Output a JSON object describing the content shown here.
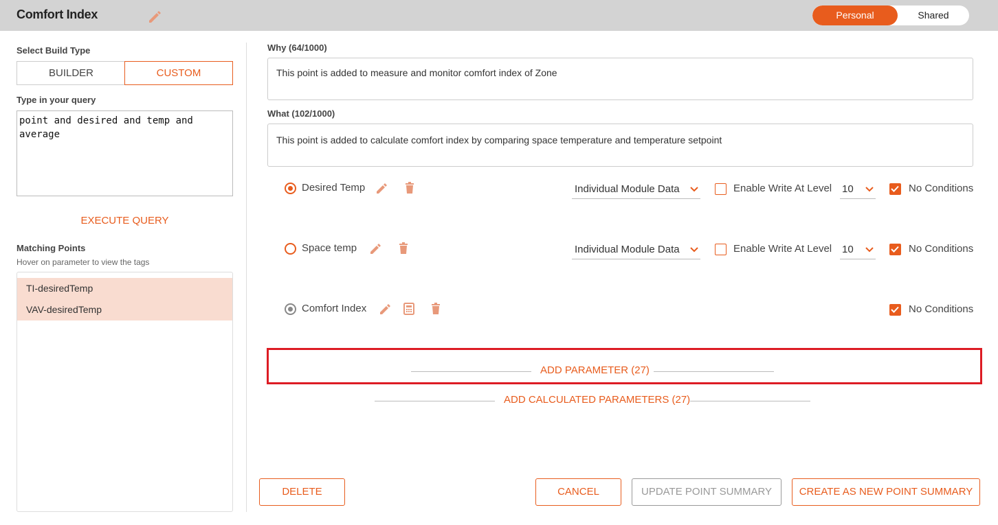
{
  "header": {
    "title": "Comfort Index",
    "toggle": {
      "personal": "Personal",
      "shared": "Shared",
      "selected": "Personal"
    }
  },
  "left": {
    "build_type_label": "Select Build Type",
    "builder_label": "BUILDER",
    "custom_label": "CUSTOM",
    "query_label": "Type in your query",
    "query_value": "point and desired and temp and\naverage",
    "execute_label": "EXECUTE QUERY",
    "matching_label": "Matching Points",
    "matching_hint": "Hover on parameter to view the tags",
    "matching_points": [
      "TI-desiredTemp",
      "VAV-desiredTemp"
    ]
  },
  "right": {
    "why_label": "Why (64/1000)",
    "why_value": "This point is added to measure and monitor comfort index of Zone",
    "what_label": "What (102/1000)",
    "what_value": "This point is added to calculate comfort index by comparing space temperature and temperature setpoint",
    "params": [
      {
        "name": "Desired Temp",
        "data_source": "Individual Module Data",
        "write_label": "Enable Write At Level",
        "level": "10",
        "conditions_label": "No Conditions"
      },
      {
        "name": "Space temp",
        "data_source": "Individual Module Data",
        "write_label": "Enable Write At Level",
        "level": "10",
        "conditions_label": "No Conditions"
      },
      {
        "name": "Comfort Index",
        "conditions_label": "No Conditions"
      }
    ],
    "add_parameter": "ADD PARAMETER (27)",
    "add_calculated": "ADD CALCULATED PARAMETERS (27)"
  },
  "footer": {
    "delete": "DELETE",
    "cancel": "CANCEL",
    "update": "UPDATE POINT SUMMARY",
    "create": "CREATE AS NEW POINT SUMMARY"
  },
  "colors": {
    "accent": "#e85c1d",
    "highlight": "#f9dcd0",
    "header_bg": "#d3d3d3",
    "annotation": "#dd1c24"
  }
}
